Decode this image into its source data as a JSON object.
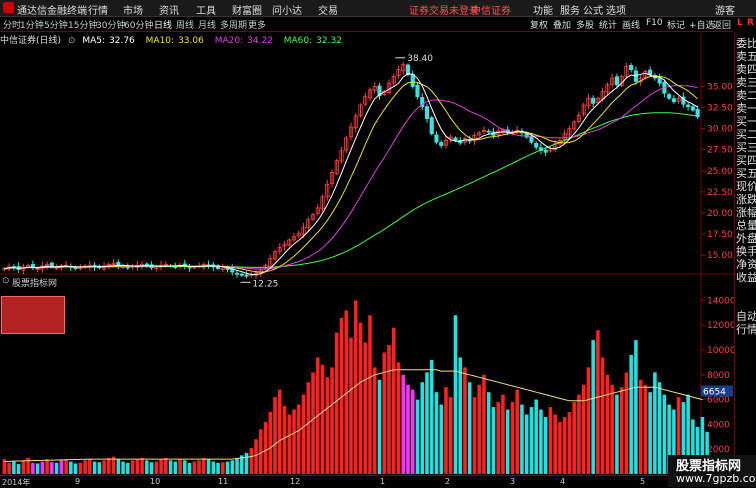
{
  "window": {
    "title": "通达信金融终端",
    "menus": [
      "行情",
      "市场",
      "资讯",
      "工具",
      "财富圈",
      "问小达",
      "交易"
    ],
    "login_status": "证券交易未登录",
    "broker": "中信证券",
    "right_menus": [
      "功能",
      "服务",
      "公式",
      "选项"
    ],
    "guest": "游客"
  },
  "period_tabs": [
    "分时",
    "1分钟",
    "5分钟",
    "15分钟",
    "30分钟",
    "60分钟",
    "日线",
    "周线",
    "月线",
    "多周期",
    "更多"
  ],
  "active_period": "日线",
  "toolbar_buttons": [
    "复权",
    "叠加",
    "多股",
    "统计",
    "画线",
    "F10",
    "标记",
    "+自选",
    "返回"
  ],
  "lr": {
    "l": "L",
    "r": "R"
  },
  "stock": {
    "name": "中信证券(日线)"
  },
  "ma_legend": [
    {
      "label": "MA5:",
      "value": "32.76",
      "color": "#ffffff"
    },
    {
      "label": "MA10:",
      "value": "33.06",
      "color": "#f0e020"
    },
    {
      "label": "MA20:",
      "value": "34.22",
      "color": "#e040e0"
    },
    {
      "label": "MA60:",
      "value": "32.32",
      "color": "#40ff40"
    }
  ],
  "quote_labels": [
    "委比",
    "卖五",
    "卖四",
    "卖三",
    "卖二",
    "卖一",
    "买一",
    "买二",
    "买三",
    "买四",
    "买五",
    "现价",
    "涨跌",
    "涨幅",
    "总量",
    "外盘",
    "换手",
    "净资",
    "收益"
  ],
  "tail_labels": [
    "自动",
    "行情"
  ],
  "indicator": {
    "name": "股票指标网",
    "current_value": "6654"
  },
  "bottom": {
    "year": "2014年",
    "months": [
      "9",
      "10",
      "11",
      "12",
      "1",
      "2",
      "3",
      "4",
      "5"
    ]
  },
  "watermark": {
    "line1": "股票指标网",
    "line2": "www.7gpzb.com"
  },
  "chart_data": {
    "type": "candlestick",
    "price_axis": {
      "ticks": [
        15,
        17.5,
        20,
        22.5,
        25,
        27.5,
        30,
        32.5,
        35
      ],
      "ylim": [
        13.0,
        39.8
      ]
    },
    "annotations": {
      "high": "38.40",
      "low": "12.25"
    },
    "indicator_axis": {
      "ticks": [
        2000,
        4000,
        6000,
        8000,
        10000,
        12000,
        14000
      ],
      "ylim": [
        0,
        15000
      ]
    },
    "series_close": [
      13.4,
      13.6,
      13.5,
      13.3,
      13.6,
      13.8,
      13.5,
      13.4,
      13.7,
      13.9,
      13.6,
      13.5,
      13.7,
      13.8,
      13.6,
      13.4,
      13.5,
      13.7,
      13.8,
      13.6,
      13.5,
      13.7,
      13.9,
      14.0,
      13.8,
      13.6,
      13.5,
      13.7,
      13.8,
      13.9,
      13.7,
      13.5,
      13.6,
      13.8,
      13.9,
      13.7,
      13.6,
      13.8,
      13.7,
      13.5,
      13.6,
      13.7,
      13.9,
      13.8,
      13.6,
      13.4,
      13.5,
      13.3,
      13.0,
      12.8,
      12.6,
      12.5,
      12.7,
      12.9,
      13.3,
      13.8,
      14.6,
      15.4,
      15.9,
      16.3,
      16.8,
      17.2,
      17.6,
      18.3,
      19.2,
      19.8,
      20.6,
      21.9,
      23.4,
      24.8,
      26.2,
      27.4,
      28.9,
      30.2,
      31.5,
      32.8,
      33.8,
      34.6,
      35.0,
      33.9,
      34.4,
      35.4,
      36.2,
      37.0,
      37.6,
      36.4,
      35.0,
      33.8,
      32.6,
      31.2,
      29.4,
      28.4,
      28.0,
      28.6,
      29.0,
      28.6,
      28.3,
      28.8,
      28.6,
      29.2,
      29.5,
      29.8,
      29.6,
      29.2,
      29.7,
      29.9,
      29.5,
      29.6,
      29.8,
      29.5,
      29.0,
      28.4,
      27.8,
      27.4,
      27.2,
      27.6,
      28.2,
      28.6,
      29.4,
      30.0,
      30.8,
      31.6,
      32.8,
      33.6,
      33.0,
      33.6,
      34.4,
      35.2,
      36.0,
      35.2,
      36.2,
      37.4,
      37.0,
      35.6,
      36.0,
      36.8,
      36.4,
      36.0,
      35.4,
      34.2,
      33.6,
      33.2,
      33.6,
      32.9,
      32.6,
      32.2,
      31.4
    ],
    "volume_values": [
      1200,
      900,
      1000,
      800,
      1100,
      1300,
      900,
      850,
      1000,
      1200,
      950,
      900,
      1100,
      1200,
      1000,
      850,
      900,
      1100,
      1250,
      1000,
      950,
      1100,
      1300,
      1400,
      1200,
      1000,
      900,
      1100,
      1200,
      1300,
      1100,
      950,
      1000,
      1200,
      1300,
      1100,
      1000,
      1200,
      1100,
      900,
      1000,
      1100,
      1300,
      1200,
      1000,
      900,
      950,
      1000,
      1100,
      1300,
      1500,
      1700,
      2100,
      2800,
      3600,
      4200,
      5000,
      6200,
      6800,
      5500,
      4800,
      5200,
      5600,
      6400,
      7400,
      8200,
      9400,
      8800,
      7800,
      8600,
      11400,
      12600,
      13200,
      11000,
      14000,
      12200,
      10600,
      12800,
      8600,
      7600,
      9800,
      10400,
      11800,
      9000,
      8000,
      7200,
      6800,
      6000,
      7400,
      8200,
      9200,
      6600,
      5600,
      7000,
      6200,
      12800,
      9400,
      8600,
      7400,
      6200,
      7200,
      8000,
      6600,
      5400,
      5800,
      6400,
      5200,
      5800,
      6800,
      5600,
      4800,
      5400,
      6000,
      5200,
      4600,
      5400,
      4800,
      4200,
      4600,
      5000,
      5800,
      6400,
      7200,
      8600,
      10800,
      11600,
      9400,
      8000,
      7200,
      6400,
      7000,
      8200,
      9600,
      10800,
      7600,
      7200,
      6600,
      8200,
      7400,
      6400,
      5600,
      5200,
      6200,
      5800,
      6400,
      4400,
      3800,
      4600,
      3400
    ],
    "volume_ma": [
      1000,
      1020,
      1040,
      1050,
      1060,
      1070,
      1080,
      1090,
      1100,
      1110,
      1120,
      1130,
      1140,
      1150,
      1160,
      1170,
      1180,
      1190,
      1200,
      1200,
      1200,
      1200,
      1200,
      1200,
      1200,
      1200,
      1200,
      1200,
      1200,
      1200,
      1200,
      1200,
      1200,
      1200,
      1200,
      1200,
      1200,
      1200,
      1200,
      1200,
      1200,
      1200,
      1200,
      1200,
      1200,
      1200,
      1200,
      1200,
      1200,
      1250,
      1300,
      1350,
      1400,
      1500,
      1700,
      1900,
      2100,
      2400,
      2700,
      2900,
      3100,
      3300,
      3500,
      3800,
      4100,
      4400,
      4700,
      5000,
      5300,
      5600,
      5900,
      6200,
      6500,
      6800,
      7100,
      7400,
      7600,
      7800,
      8000,
      8100,
      8200,
      8300,
      8400,
      8400,
      8400,
      8400,
      8400,
      8400,
      8400,
      8400,
      8400,
      8400,
      8300,
      8300,
      8300,
      8300,
      8200,
      8100,
      8000,
      7900,
      7800,
      7700,
      7600,
      7500,
      7400,
      7300,
      7200,
      7100,
      7000,
      6900,
      6800,
      6700,
      6600,
      6500,
      6400,
      6300,
      6200,
      6100,
      6000,
      5900,
      5900,
      5900,
      5900,
      6000,
      6100,
      6200,
      6300,
      6400,
      6500,
      6600,
      6700,
      6800,
      6900,
      7000,
      7000,
      7000,
      7000,
      7000,
      6900,
      6800,
      6700,
      6600,
      6500,
      6400,
      6300,
      6200,
      6100,
      6000
    ]
  }
}
